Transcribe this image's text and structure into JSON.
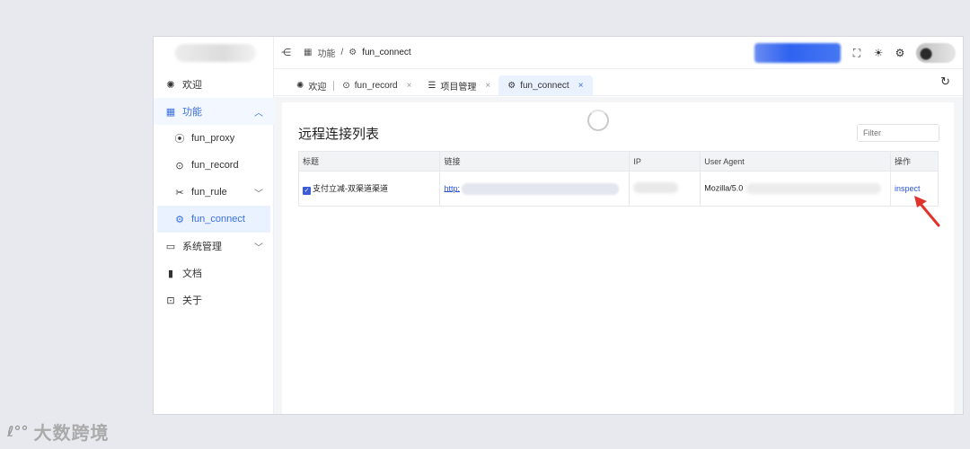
{
  "sidebar": {
    "items": [
      {
        "label": "欢迎",
        "icon": "welcome-icon"
      },
      {
        "label": "功能",
        "icon": "grid-icon"
      },
      {
        "label": "fun_proxy",
        "icon": "broadcast-icon"
      },
      {
        "label": "fun_record",
        "icon": "record-icon"
      },
      {
        "label": "fun_rule",
        "icon": "tools-icon"
      },
      {
        "label": "fun_connect",
        "icon": "gear-icon"
      },
      {
        "label": "系统管理",
        "icon": "monitor-icon"
      },
      {
        "label": "文档",
        "icon": "book-icon"
      },
      {
        "label": "关于",
        "icon": "info-icon"
      }
    ]
  },
  "header": {
    "breadcrumb": [
      "功能",
      "fun_connect"
    ],
    "separator": "/"
  },
  "tabs": [
    {
      "label": "欢迎"
    },
    {
      "label": "fun_record"
    },
    {
      "label": "项目管理"
    },
    {
      "label": "fun_connect"
    }
  ],
  "main": {
    "title": "远程连接列表",
    "filter_placeholder": "Filter",
    "table": {
      "headers": [
        "标题",
        "链接",
        "IP",
        "User Agent",
        "操作"
      ],
      "rows": [
        {
          "title": "支付立减-双渠道渠道",
          "link": "http:",
          "ua": "Mozilla/5.0",
          "action": "inspect"
        }
      ]
    }
  },
  "watermark": {
    "text": "大数跨境"
  },
  "colors": {
    "accent": "#3b6fe0",
    "arrow": "#e0332b"
  }
}
